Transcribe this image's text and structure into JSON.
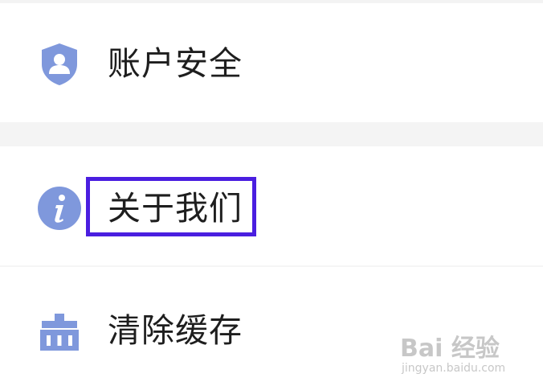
{
  "settings_menu": {
    "items": [
      {
        "label": "账户安全",
        "icon": "shield-user-icon"
      },
      {
        "label": "关于我们",
        "icon": "info-icon",
        "highlighted": true
      },
      {
        "label": "清除缓存",
        "icon": "basket-icon"
      }
    ]
  },
  "colors": {
    "icon": "#7f98dc",
    "highlight_border": "#4a1ee0",
    "text": "#1e1e1e",
    "section_gap": "#f4f4f4"
  },
  "watermark": {
    "logo": "Bai 经验",
    "url": "jingyan.baidu.com"
  }
}
